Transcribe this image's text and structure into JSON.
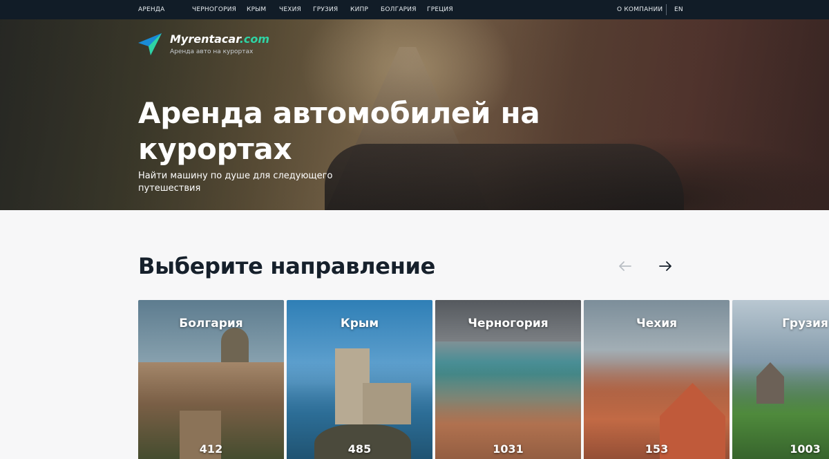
{
  "topnav": {
    "items": [
      "АРЕНДА",
      "ЧЕРНОГОРИЯ",
      "КРЫМ",
      "ЧЕХИЯ",
      "ГРУЗИЯ",
      "КИПР",
      "БОЛГАРИЯ",
      "ГРЕЦИЯ"
    ],
    "about": "О КОМПАНИИ",
    "lang": "EN"
  },
  "logo": {
    "name_main": "Myrentacar",
    "name_domain": ".com",
    "tagline": "Аренда авто на курортах",
    "colors": {
      "brand": "#2fd3a4",
      "brand_dark": "#1a8bd6"
    }
  },
  "hero": {
    "title": "Аренда автомобилей на курортах",
    "subtitle": "Найти машину по душе для следующего путешествия"
  },
  "section": {
    "title": "Выберите направление",
    "prev_icon": "arrow-left-icon",
    "next_icon": "arrow-right-icon"
  },
  "destinations": [
    {
      "name": "Болгария",
      "count": "412"
    },
    {
      "name": "Крым",
      "count": "485"
    },
    {
      "name": "Черногория",
      "count": "1031"
    },
    {
      "name": "Чехия",
      "count": "153"
    },
    {
      "name": "Грузия",
      "count": "1003"
    }
  ],
  "colors": {
    "topbar": "#111c27",
    "page_bg": "#f7f7f8",
    "heading": "#16202b",
    "accent": "#2fd3a4"
  }
}
